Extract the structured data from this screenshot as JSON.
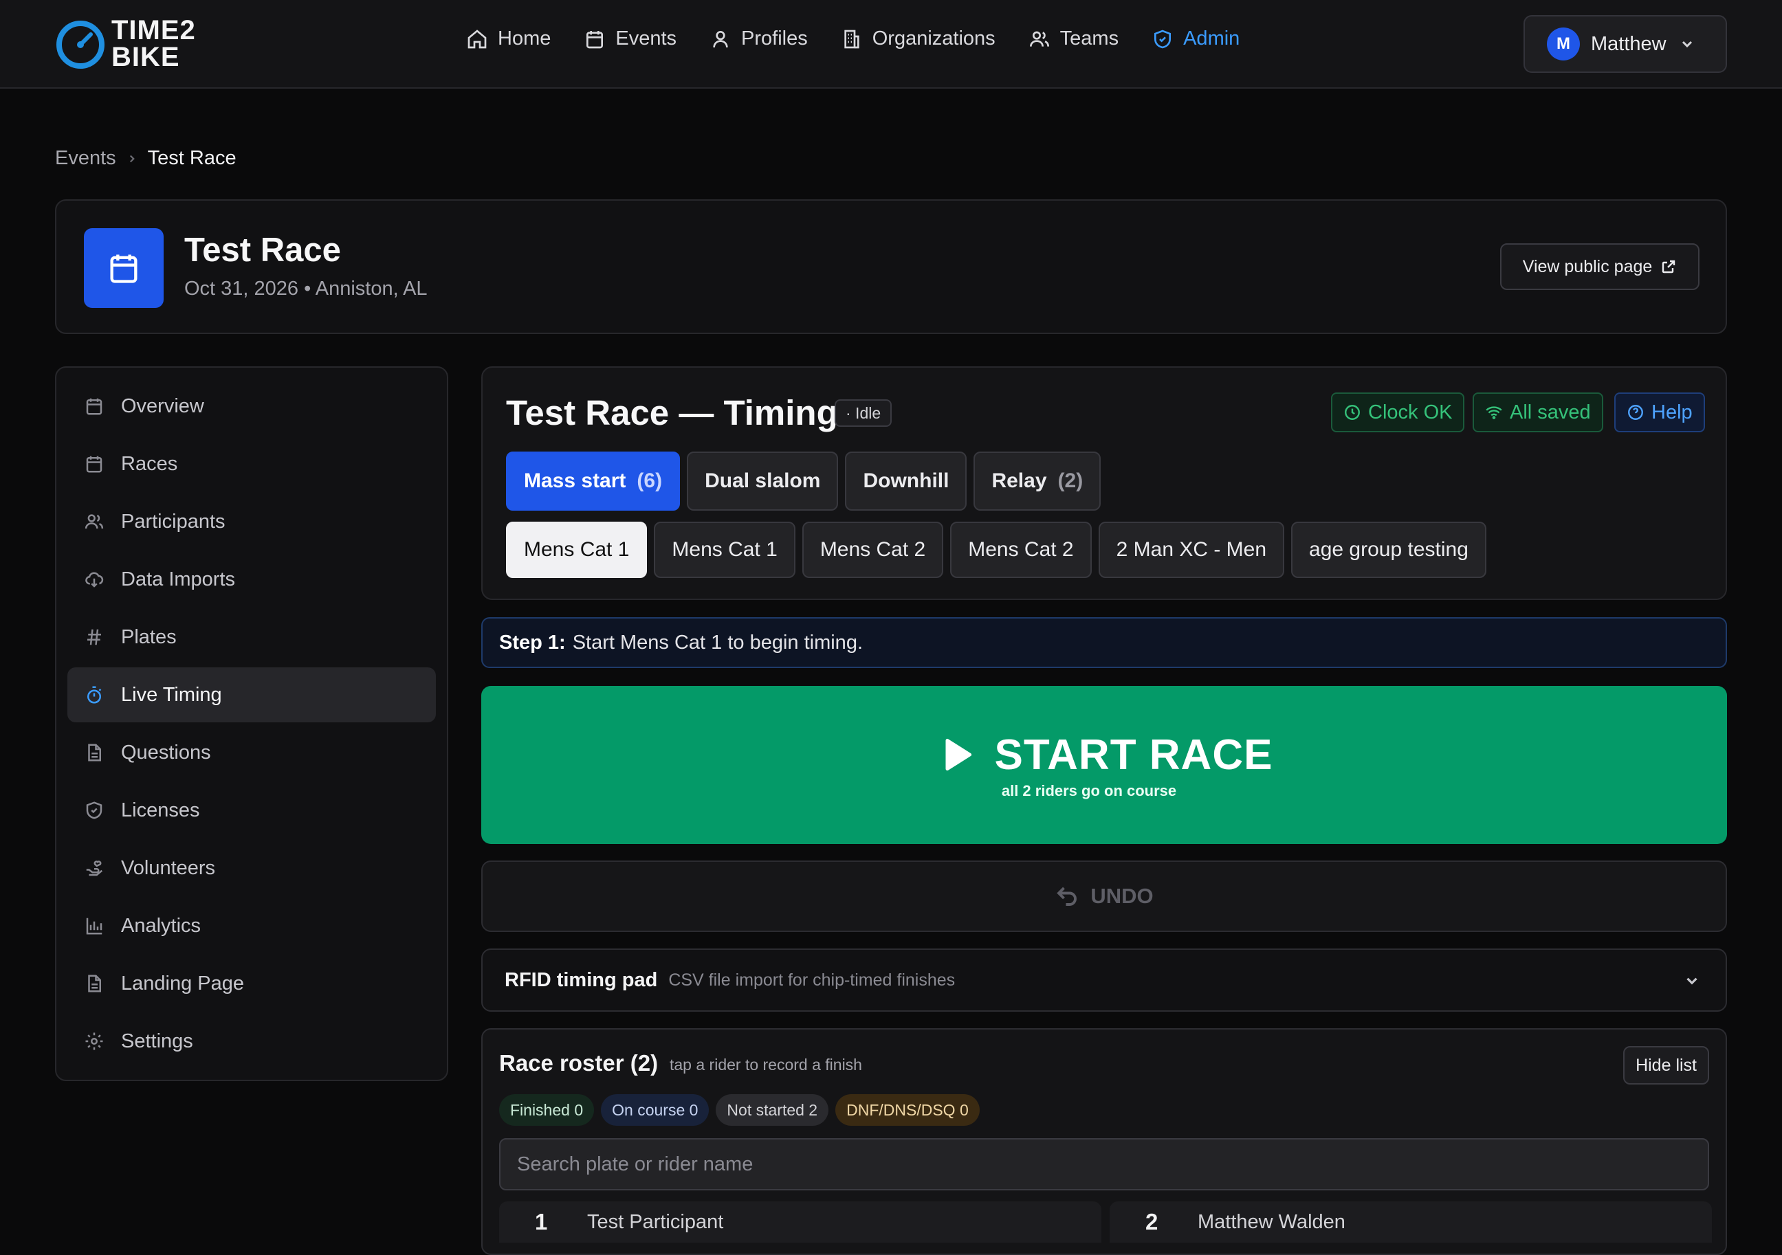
{
  "brand": {
    "line1": "TIME2",
    "line2": "BIKE",
    "accent": "#1f8fe0"
  },
  "nav": {
    "items": [
      {
        "label": "Home",
        "icon": "home-icon"
      },
      {
        "label": "Events",
        "icon": "calendar-icon"
      },
      {
        "label": "Profiles",
        "icon": "user-icon"
      },
      {
        "label": "Organizations",
        "icon": "building-icon"
      },
      {
        "label": "Teams",
        "icon": "users-icon"
      },
      {
        "label": "Admin",
        "icon": "shield-icon",
        "color": "#3b9cff"
      }
    ],
    "user": {
      "initial": "M",
      "name": "Matthew"
    }
  },
  "breadcrumb": {
    "parent": "Events",
    "current": "Test Race"
  },
  "event": {
    "title": "Test Race",
    "subtitle": "Oct 31, 2026 • Anniston, AL",
    "public_button": "View public page"
  },
  "sidebar": {
    "items": [
      {
        "label": "Overview",
        "icon": "calendar-icon"
      },
      {
        "label": "Races",
        "icon": "calendar-icon"
      },
      {
        "label": "Participants",
        "icon": "users-icon"
      },
      {
        "label": "Data Imports",
        "icon": "cloud-download-icon"
      },
      {
        "label": "Plates",
        "icon": "hash-icon"
      },
      {
        "label": "Live Timing",
        "icon": "stopwatch-icon",
        "active": true
      },
      {
        "label": "Questions",
        "icon": "document-icon"
      },
      {
        "label": "Licenses",
        "icon": "shield-icon"
      },
      {
        "label": "Volunteers",
        "icon": "hand-heart-icon"
      },
      {
        "label": "Analytics",
        "icon": "bar-chart-icon"
      },
      {
        "label": "Landing Page",
        "icon": "document-icon"
      },
      {
        "label": "Settings",
        "icon": "gear-icon"
      }
    ]
  },
  "timing": {
    "title": "Test Race — Timing",
    "state": "· Idle",
    "clock_status": "Clock OK",
    "save_status": "All saved",
    "help": "Help",
    "modes": [
      {
        "label": "Mass start",
        "count": "(6)",
        "selected": true
      },
      {
        "label": "Dual slalom",
        "count": ""
      },
      {
        "label": "Downhill",
        "count": ""
      },
      {
        "label": "Relay",
        "count": "(2)"
      }
    ],
    "races": [
      {
        "label": "Mens Cat 1",
        "selected": true
      },
      {
        "label": "Mens Cat 1"
      },
      {
        "label": "Mens Cat 2"
      },
      {
        "label": "Mens Cat 2"
      },
      {
        "label": "2 Man XC - Men"
      },
      {
        "label": "age group testing"
      }
    ],
    "step_label": "Step 1:",
    "step_text": "Start Mens Cat 1 to begin timing.",
    "start_label": "START RACE",
    "start_sub": "all 2 riders go on course",
    "undo_label": "UNDO"
  },
  "rfid": {
    "title": "RFID timing pad",
    "description": "CSV file import for chip-timed finishes"
  },
  "roster": {
    "title": "Race roster (2)",
    "hint": "tap a rider to record a finish",
    "hide_button": "Hide list",
    "chips": {
      "finished": "Finished 0",
      "on_course": "On course 0",
      "not_started": "Not started 2",
      "dnf": "DNF/DNS/DSQ 0"
    },
    "search_placeholder": "Search plate or rider name",
    "riders": [
      {
        "plate": "1",
        "name": "Test Participant"
      },
      {
        "plate": "2",
        "name": "Matthew Walden"
      }
    ]
  },
  "colors": {
    "primary": "#1f56e8",
    "start_green": "#049a68",
    "ok_green": "#35c27a",
    "link_blue": "#3b9cff"
  }
}
